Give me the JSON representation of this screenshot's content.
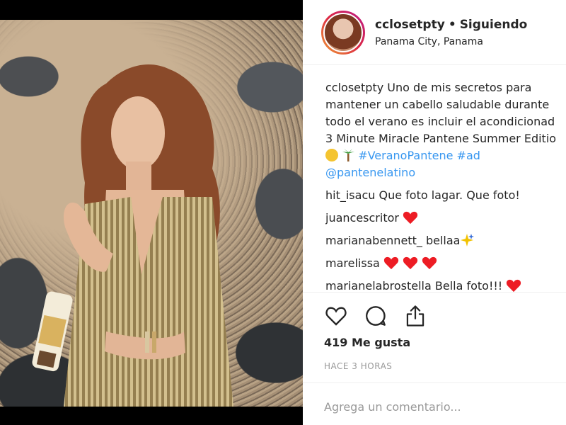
{
  "post": {
    "username": "cclosetpty",
    "separator": "•",
    "follow_status": "Siguiendo",
    "location": "Panama City, Panama"
  },
  "caption": {
    "username": "cclosetpty",
    "line1": "Uno de mis secretos para",
    "line2": "mantener un cabello saludable durante",
    "line3": "todo el verano es incluir el acondicionad",
    "line4": "3 Minute Miracle Pantene Summer Editio",
    "hashtag1": "#VeranoPantene",
    "hashtag2": "#ad",
    "mention": "@pantenelatino"
  },
  "comments": [
    {
      "user": "hit_isacu",
      "text": "Que foto lagar. Que foto!"
    },
    {
      "user": "juancescritor",
      "text": "",
      "emoji": "heart-x1"
    },
    {
      "user": "marianabennett_",
      "text": "bellaa",
      "emoji": "sparkle"
    },
    {
      "user": "marelissa",
      "text": "",
      "emoji": "heart-x3"
    },
    {
      "user": "marianelabrostella",
      "text": "Bella foto!!!",
      "emoji": "heart"
    }
  ],
  "engagement": {
    "likes": "419 Me gusta",
    "timestamp": "HACE 3 HORAS"
  },
  "comment_box": {
    "placeholder": "Agrega un comentario..."
  },
  "colors": {
    "link": "#3897f0",
    "heart": "#ed1c24",
    "text": "#262626",
    "muted": "#999999"
  },
  "icons": [
    "heart-outline-icon",
    "comment-bubble-icon",
    "share-upload-icon"
  ]
}
